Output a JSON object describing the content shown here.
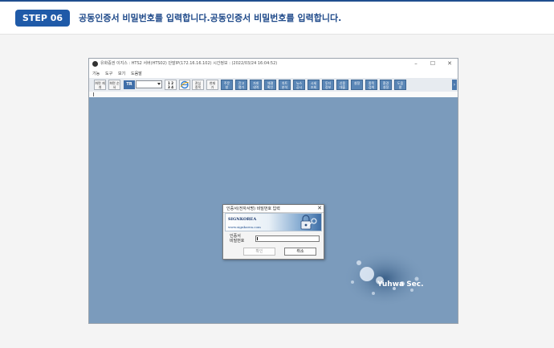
{
  "step": {
    "badge": "STEP 06",
    "instruction": "공동인증서 비밀번호를 입력합니다.공동인증서 비밀번호를 입력합니다."
  },
  "window": {
    "title": "유화증권 이지스 : HTS2 서버(HTS02) 단말IP(172.16.16.102)   시간정보 : (2022/03/24 16:04:52)",
    "controls": [
      "–",
      "☐",
      "✕"
    ]
  },
  "menu": [
    "기능",
    "도구",
    "보기",
    "도움말"
  ],
  "toolbar": {
    "left_buttons": [
      "화면\n재개",
      "화면\n순서"
    ],
    "tr_label": "TR",
    "layout_digits": "1 2\n3 4",
    "buttons": [
      "관심\n종목",
      "현재\n가",
      "주문\n창",
      "잔고\n평가",
      "거래\n내역",
      "체결\n확인",
      "차트\n분석",
      "뉴스\n공시",
      "시세\n조회",
      "투자\n정보",
      "신용\n대출",
      "설정",
      "종목\n검색",
      "환경\n설정",
      "도움\n말"
    ],
    "more_icon": "chevron-right-icon"
  },
  "dialog": {
    "title": "인증서(전자서명) 비밀번호 입력",
    "close_icon": "close-icon",
    "brand": "SIGNKOREA",
    "brand_url": "www.signkorea.com",
    "field_label_line1": "인증서",
    "field_label_line2": "비밀번호",
    "password_value": "",
    "confirm_label": "확인",
    "cancel_label": "취소"
  },
  "watermark": {
    "text": "Yuhwa Sec."
  },
  "colors": {
    "step_badge": "#1f5aa8",
    "desktop": "#7b9bbc",
    "toolbar_blue": "#5a86b6"
  }
}
